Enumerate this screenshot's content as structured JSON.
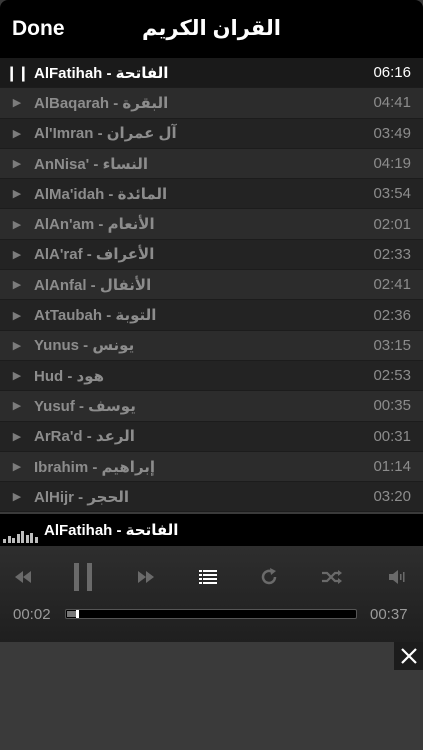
{
  "header": {
    "done_label": "Done",
    "title": "القران الكريم"
  },
  "tracks": [
    {
      "name": "AlFatihah - الفاتحة",
      "duration": "06:16",
      "active": true
    },
    {
      "name": "AlBaqarah - البقرة",
      "duration": "04:41"
    },
    {
      "name": "Al'Imran - آل عمران",
      "duration": "03:49"
    },
    {
      "name": "AnNisa' - النساء",
      "duration": "04:19"
    },
    {
      "name": "AlMa'idah - المائدة",
      "duration": "03:54"
    },
    {
      "name": "AlAn'am - الأنعام",
      "duration": "02:01"
    },
    {
      "name": "AlA'raf - الأعراف",
      "duration": "02:33"
    },
    {
      "name": "AlAnfal - الأنفال",
      "duration": "02:41"
    },
    {
      "name": "AtTaubah - التوبة",
      "duration": "02:36"
    },
    {
      "name": "Yunus - يونس",
      "duration": "03:15"
    },
    {
      "name": "Hud - هود",
      "duration": "02:53"
    },
    {
      "name": "Yusuf - يوسف",
      "duration": "00:35"
    },
    {
      "name": "ArRa'd - الرعد",
      "duration": "00:31"
    },
    {
      "name": "Ibrahim - إبراهيم",
      "duration": "01:14"
    },
    {
      "name": "AlHijr - الحجر",
      "duration": "03:20"
    }
  ],
  "now_playing": {
    "title": "AlFatihah - الفاتحة"
  },
  "player": {
    "elapsed": "00:02",
    "remaining": "00:37",
    "progress_fraction": 0.03,
    "icons": [
      "rewind-icon",
      "pause-icon",
      "fast-forward-icon",
      "playlist-icon",
      "repeat-icon",
      "shuffle-icon",
      "volume-icon"
    ]
  },
  "colors": {
    "accent": "#ffffff",
    "header_bg": "#000000",
    "row_text": "#8c8c8c"
  }
}
